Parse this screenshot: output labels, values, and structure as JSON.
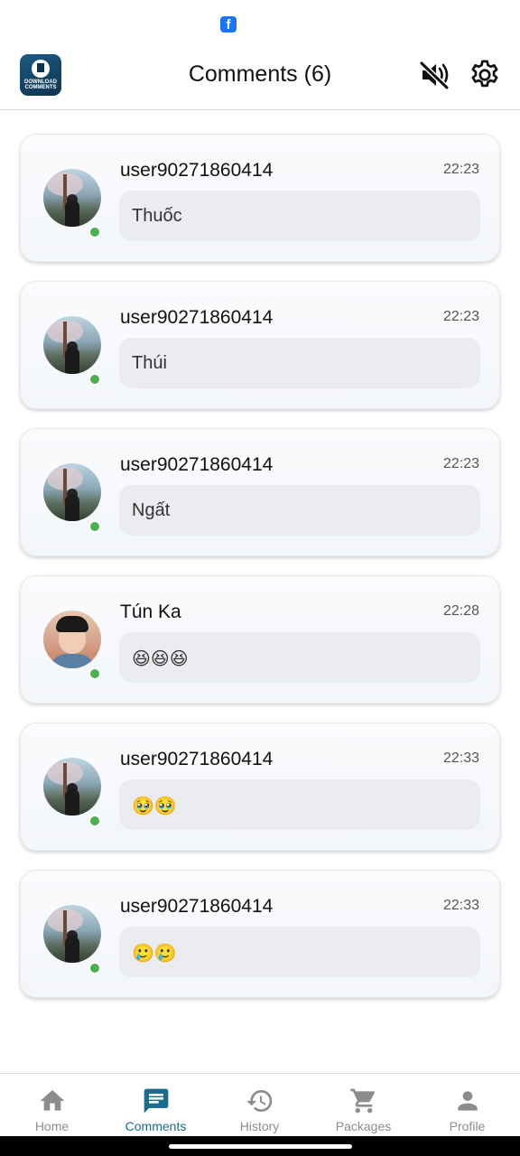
{
  "status_bar": {
    "notification_icon": "facebook-icon"
  },
  "header": {
    "logo_icon": "download-comments-logo",
    "logo_text": "DOWNLOAD COMMENTS",
    "title": "Comments (6)",
    "mute_icon": "volume-off-icon",
    "settings_icon": "gear-icon"
  },
  "comments": [
    {
      "username": "user90271860414",
      "time": "22:23",
      "text": "Thuốc",
      "avatar": "tree-avatar",
      "online": true
    },
    {
      "username": "user90271860414",
      "time": "22:23",
      "text": "Thúi",
      "avatar": "tree-avatar",
      "online": true
    },
    {
      "username": "user90271860414",
      "time": "22:23",
      "text": "Ngất",
      "avatar": "tree-avatar",
      "online": true
    },
    {
      "username": "Tún Ka",
      "time": "22:28",
      "text": "😆😆😆",
      "avatar": "man-avatar",
      "online": true
    },
    {
      "username": "user90271860414",
      "time": "22:33",
      "text": "🥹🥹",
      "avatar": "tree-avatar",
      "online": true
    },
    {
      "username": "user90271860414",
      "time": "22:33",
      "text": "🥲🥲",
      "avatar": "tree-avatar",
      "online": true
    }
  ],
  "bottom_nav": {
    "active": "Comments",
    "items": [
      {
        "label": "Home",
        "icon": "home-icon"
      },
      {
        "label": "Comments",
        "icon": "chat-icon"
      },
      {
        "label": "History",
        "icon": "history-icon"
      },
      {
        "label": "Packages",
        "icon": "cart-icon"
      },
      {
        "label": "Profile",
        "icon": "person-icon"
      }
    ]
  },
  "colors": {
    "accent": "#1a6d8c",
    "online": "#4caf50",
    "inactive_nav": "#8c8c8c",
    "bubble": "#ebecf0"
  }
}
